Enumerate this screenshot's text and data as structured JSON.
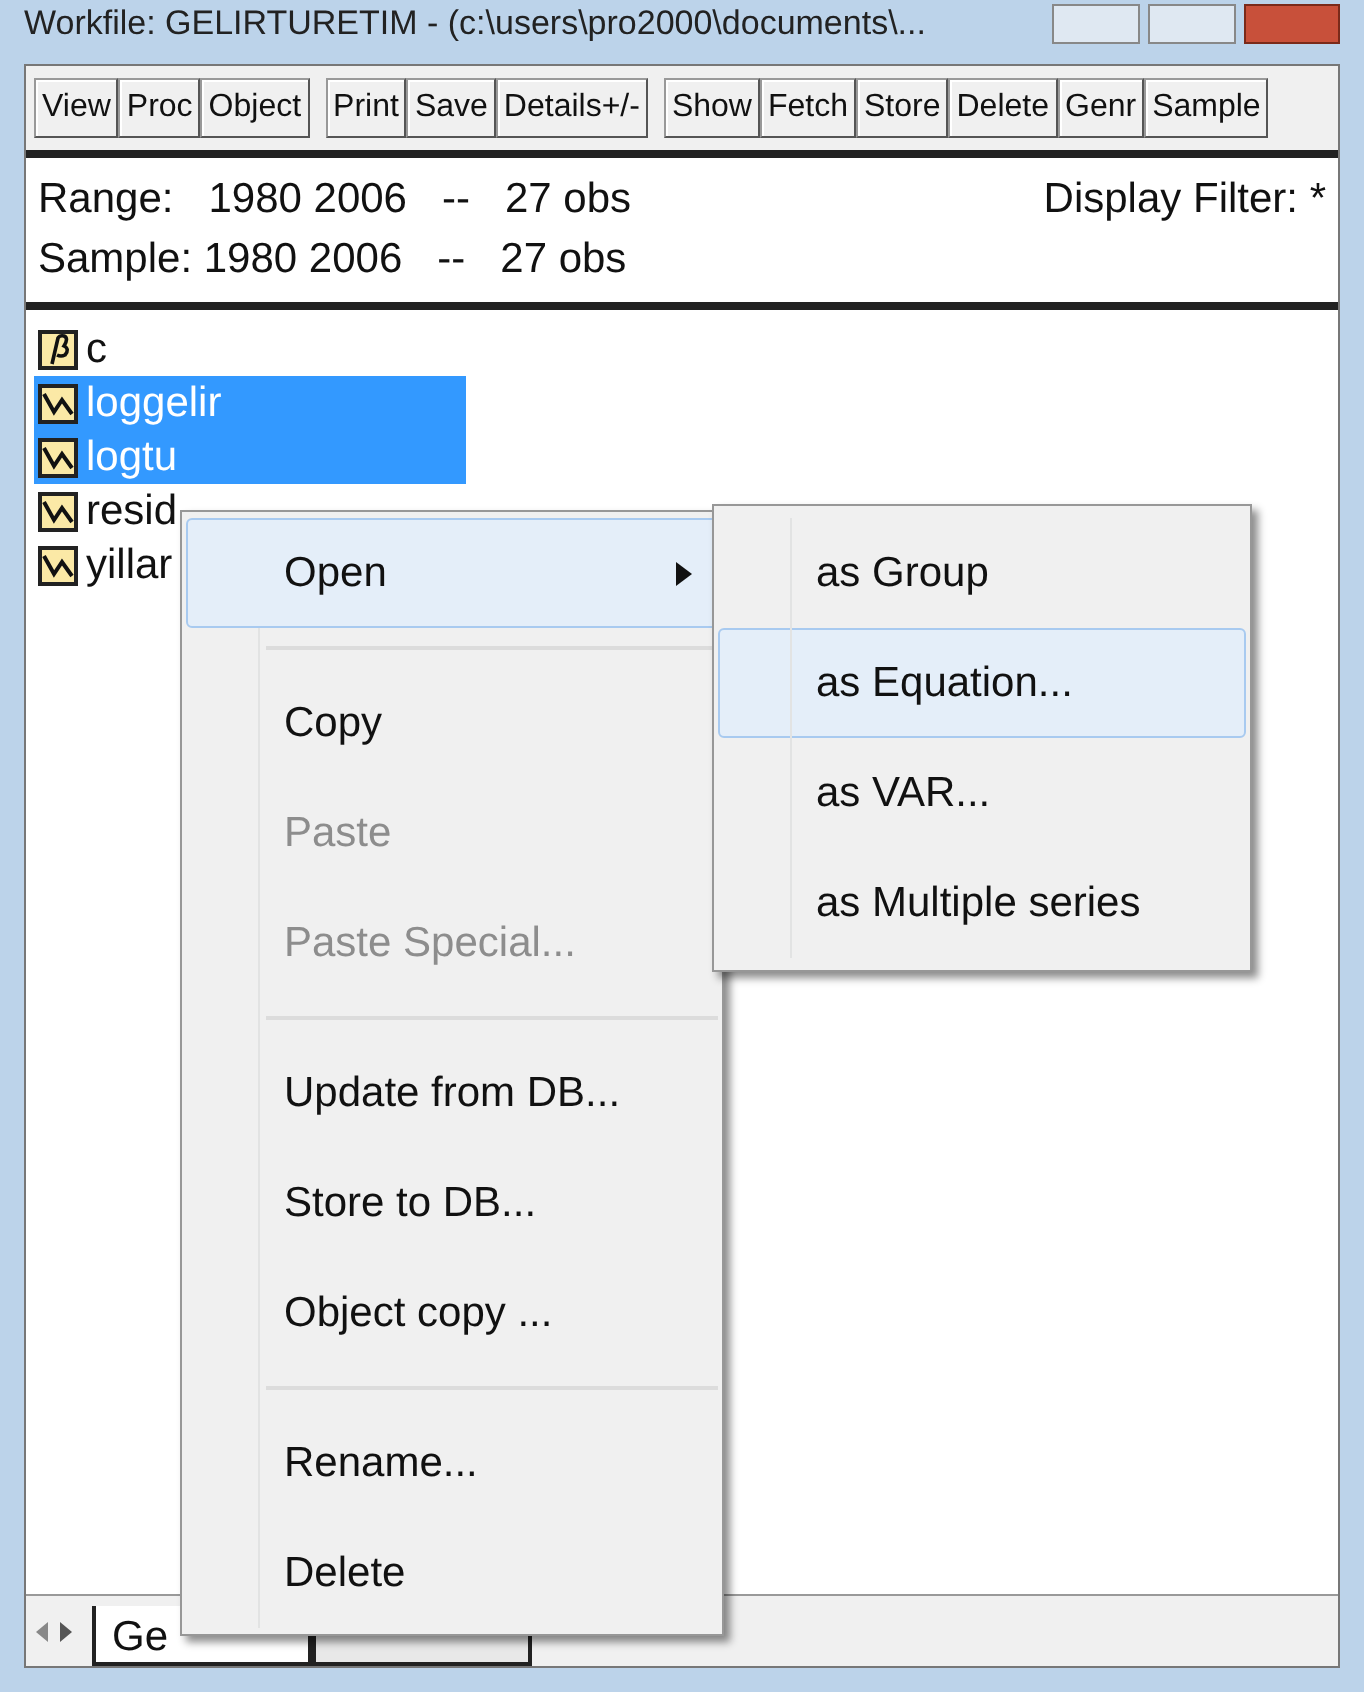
{
  "window": {
    "title": "Workfile: GELIRTURETIM - (c:\\users\\pro2000\\documents\\..."
  },
  "toolbar": [
    {
      "buttons": [
        "View",
        "Proc",
        "Object"
      ]
    },
    {
      "buttons": [
        "Print",
        "Save",
        "Details+/-"
      ]
    },
    {
      "buttons": [
        "Show",
        "Fetch",
        "Store",
        "Delete",
        "Genr",
        "Sample"
      ]
    }
  ],
  "info": {
    "range": "Range:   1980 2006   --   27 obs",
    "sample": "Sample: 1980 2006   --   27 obs",
    "filter": "Display Filter: *"
  },
  "objects": [
    {
      "kind": "coef",
      "name": "c",
      "selected": false
    },
    {
      "kind": "series",
      "name": "loggelir",
      "selected": true
    },
    {
      "kind": "series",
      "name": "logtu",
      "selected": true
    },
    {
      "kind": "series",
      "name": "resid",
      "selected": false
    },
    {
      "kind": "series",
      "name": "yillar",
      "selected": false
    }
  ],
  "context_menu": [
    {
      "kind": "item",
      "label": "Open",
      "selected": true,
      "disabled": false,
      "submenu": true
    },
    {
      "kind": "separator"
    },
    {
      "kind": "item",
      "label": "Copy",
      "selected": false,
      "disabled": false,
      "submenu": false
    },
    {
      "kind": "item",
      "label": "Paste",
      "selected": false,
      "disabled": true,
      "submenu": false
    },
    {
      "kind": "item",
      "label": "Paste Special...",
      "selected": false,
      "disabled": true,
      "submenu": false
    },
    {
      "kind": "separator"
    },
    {
      "kind": "item",
      "label": "Update from DB...",
      "selected": false,
      "disabled": false,
      "submenu": false
    },
    {
      "kind": "item",
      "label": "Store to DB...",
      "selected": false,
      "disabled": false,
      "submenu": false
    },
    {
      "kind": "item",
      "label": "Object copy ...",
      "selected": false,
      "disabled": false,
      "submenu": false
    },
    {
      "kind": "separator"
    },
    {
      "kind": "item",
      "label": "Rename...",
      "selected": false,
      "disabled": false,
      "submenu": false
    },
    {
      "kind": "item",
      "label": "Delete",
      "selected": false,
      "disabled": false,
      "submenu": false
    }
  ],
  "submenu": [
    {
      "label": "as Group",
      "selected": false
    },
    {
      "label": "as Equation...",
      "selected": true
    },
    {
      "label": "as VAR...",
      "selected": false
    },
    {
      "label": "as Multiple series",
      "selected": false
    }
  ],
  "page_tabs": [
    {
      "label": "Ge",
      "selected": true
    },
    {
      "selected": false
    }
  ]
}
